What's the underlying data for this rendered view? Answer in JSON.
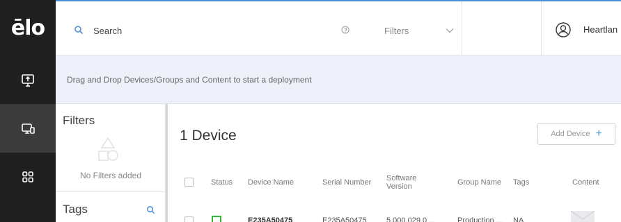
{
  "rail": {
    "logo": "ēlo",
    "items": [
      {
        "icon": "upload-screen-icon",
        "active": false
      },
      {
        "icon": "devices-icon",
        "active": true
      },
      {
        "icon": "apps-grid-icon",
        "active": false
      }
    ]
  },
  "topbar": {
    "search_placeholder": "Search",
    "filters_label": "Filters",
    "user_name": "Heartlan"
  },
  "dropbar": {
    "text": "Drag and Drop Devices/Groups and Content to start a deployment"
  },
  "filters_panel": {
    "title": "Filters",
    "empty_text": "No Filters added",
    "tags_title": "Tags"
  },
  "main": {
    "title": "1 Device",
    "add_button_label": "Add Device",
    "add_button_icon": "+",
    "columns": {
      "status": "Status",
      "device_name": "Device Name",
      "serial_number": "Serial Number",
      "software_version_line1": "Software",
      "software_version_line2": "Version",
      "group_name": "Group Name",
      "tags": "Tags",
      "content": "Content"
    },
    "rows": [
      {
        "status": "online",
        "device_name": "E235A50475",
        "serial_number": "E235A50475",
        "software_version": "5.000.029.0 ...",
        "group_name": "Production ...",
        "tags": "NA"
      }
    ]
  },
  "colors": {
    "rail_bg": "#1f1f1f",
    "rail_active": "#3b3b3b",
    "accent": "#4a90d9",
    "status_online": "#35b135",
    "dropbar_bg": "#eef1fa"
  }
}
